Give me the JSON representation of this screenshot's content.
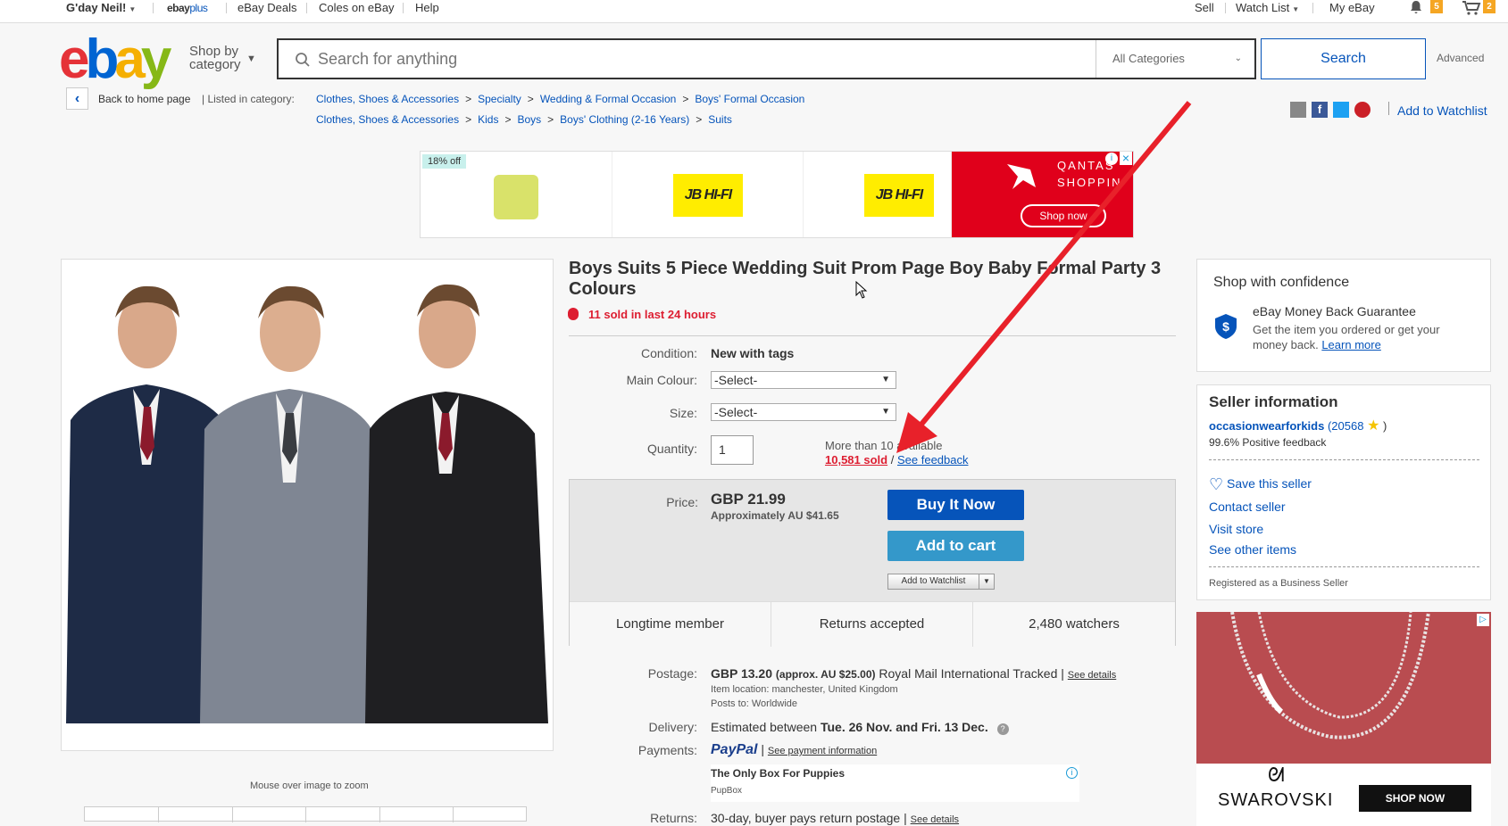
{
  "topbar": {
    "greeting": "G'day Neil!",
    "ebayplus_a": "ebay",
    "ebayplus_b": "plus",
    "deals": "eBay Deals",
    "coles": "Coles on eBay",
    "help": "Help",
    "sell": "Sell",
    "watchlist": "Watch List",
    "myebay": "My eBay",
    "notif_count": "5",
    "cart_count": "2"
  },
  "header": {
    "logo_letters": [
      "e",
      "b",
      "a",
      "y"
    ],
    "logo_colors": [
      "#e53238",
      "#0064d2",
      "#f5af02",
      "#86b817"
    ],
    "shop_by_line1": "Shop by",
    "shop_by_line2": "category",
    "search_placeholder": "Search for anything",
    "category": "All Categories",
    "search_button": "Search",
    "advanced": "Advanced"
  },
  "breadcrumb": {
    "back": "Back to home page",
    "listed_in": "| Listed in category:",
    "row1": [
      "Clothes, Shoes & Accessories",
      "Specialty",
      "Wedding & Formal Occasion",
      "Boys' Formal Occasion"
    ],
    "row2": [
      "Clothes, Shoes & Accessories",
      "Kids",
      "Boys",
      "Boys' Clothing (2-16 Years)",
      "Suits"
    ],
    "sep": ">",
    "add_watchlist": "Add to Watchlist"
  },
  "top_ad": {
    "discount": "18% off",
    "brand": "JB HI-FI",
    "qantas": "QANTAS",
    "qantas_sub": "SHOPPIN",
    "shop_now": "Shop now"
  },
  "item": {
    "title": "Boys Suits 5 Piece Wedding Suit Prom Page Boy Baby Formal Party 3 Colours",
    "sold_24": "11 sold in last 24 hours",
    "condition_label": "Condition:",
    "condition": "New with tags",
    "colour_label": "Main Colour:",
    "colour_value": "-Select-",
    "size_label": "Size:",
    "size_value": "-Select-",
    "qty_label": "Quantity:",
    "qty_value": "1",
    "available": "More than 10 available",
    "sold_total": "10,581 sold",
    "slash": "/",
    "see_feedback": "See feedback",
    "zoom_hint": "Mouse over image to zoom"
  },
  "price": {
    "label": "Price:",
    "value": "GBP 21.99",
    "approx": "Approximately AU $41.65",
    "buy_now": "Buy It Now",
    "add_cart": "Add to cart",
    "add_watch": "Add to Watchlist",
    "stats": [
      "Longtime member",
      "Returns accepted",
      "2,480 watchers"
    ]
  },
  "shipping": {
    "postage_label": "Postage:",
    "postage_value": "GBP 13.20",
    "postage_approx": "(approx. AU $25.00)",
    "postage_service": "Royal Mail International Tracked |",
    "see_details": "See details",
    "location": "Item location:  manchester, United Kingdom",
    "posts_to": "Posts to:  Worldwide",
    "delivery_label": "Delivery:",
    "delivery_prefix": "Estimated between",
    "delivery_dates": "Tue. 26 Nov. and Fri. 13 Dec.",
    "payments_label": "Payments:",
    "paypal": "PayPal",
    "payment_info": "See payment information",
    "promo_title": "The Only Box For Puppies",
    "promo_sub": "PupBox",
    "returns_label": "Returns:",
    "returns_value": "30-day, buyer pays return postage |",
    "returns_details": "See details"
  },
  "confidence": {
    "title": "Shop with confidence",
    "guarantee": "eBay Money Back Guarantee",
    "desc1": "Get the item you ordered or get your",
    "desc2": "money back.",
    "learn_more": "Learn more"
  },
  "seller": {
    "title": "Seller information",
    "name": "occasionwearforkids",
    "score": "(20568",
    "score_end": ")",
    "positive": "99.6% Positive feedback",
    "save": "Save this seller",
    "contact": "Contact seller",
    "store": "Visit store",
    "other": "See other items",
    "registered": "Registered as a Business Seller"
  },
  "side_ad": {
    "brand": "SWAROVSKI",
    "cta": "SHOP NOW"
  }
}
